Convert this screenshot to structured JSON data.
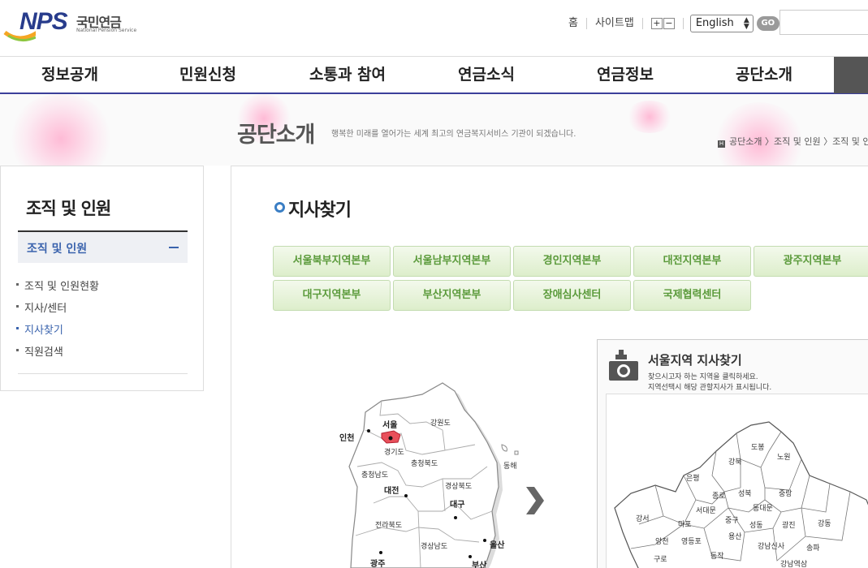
{
  "header": {
    "logo_text": "NPS",
    "logo_ko": "국민연금",
    "logo_en": "National Pension Service",
    "util_home": "홈",
    "util_sitemap": "사이트맵",
    "zoom_in": "+",
    "zoom_out": "−",
    "language": "English",
    "go_label": "GO"
  },
  "gnb": {
    "items": [
      "정보공개",
      "민원신청",
      "소통과 참여",
      "연금소식",
      "연금정보",
      "공단소개"
    ]
  },
  "visual": {
    "title": "공단소개",
    "subtitle": "행복한 미래를 열어가는 세계 최고의 연금복지서비스 기관이 되겠습니다.",
    "breadcrumb": "공단소개 〉조직 및 인원 〉조직 및 인"
  },
  "lnb": {
    "title": "조직 및 인원",
    "active": "조직 및 인원",
    "items": [
      "조직 및 인원현황",
      "지사/센터",
      "지사찾기",
      "직원검색"
    ]
  },
  "content": {
    "title": "지사찾기",
    "tabs": [
      "서울북부지역본부",
      "서울남부지역본부",
      "경인지역본부",
      "대전지역본부",
      "광주지역본부",
      "대구지역본부",
      "부산지역본부",
      "장애심사센터",
      "국제협력센터"
    ]
  },
  "korea_map": {
    "labels": [
      "서울",
      "인천",
      "강원도",
      "경기도",
      "충청북도",
      "충청남도",
      "대전",
      "경상북도",
      "대구",
      "전라북도",
      "경상남도",
      "울산",
      "광주",
      "부산",
      "동해"
    ]
  },
  "seoul_panel": {
    "title": "서울지역 지사찾기",
    "desc1": "찾으시고자 하는 지역을 클릭하세요.",
    "desc2": "지역선택시 해당 관할지사가 표시됩니다.",
    "districts": [
      "도봉",
      "노원",
      "강북",
      "은평",
      "성북",
      "중랑",
      "종로",
      "동대문",
      "서대문",
      "강서",
      "마포",
      "중구",
      "성동",
      "광진",
      "강동",
      "양천",
      "영등포",
      "용산",
      "구로",
      "동작",
      "강남신사",
      "송파",
      "강남역삼"
    ]
  },
  "colors": {
    "accent": "#3b3f9a",
    "tab_text": "#5a9a3a",
    "active_menu": "#3a63ad",
    "seoul_highlight": "#e8505b"
  }
}
